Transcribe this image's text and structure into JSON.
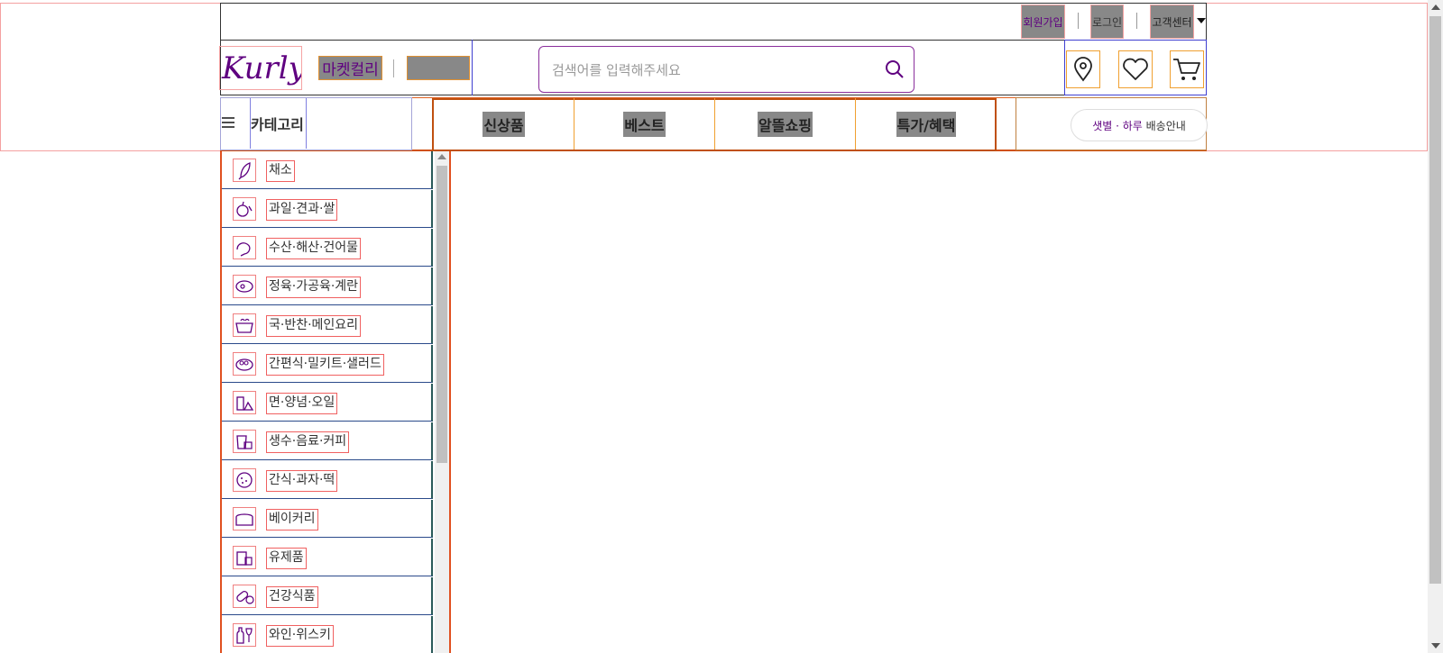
{
  "top_links": {
    "signup": "회원가입",
    "login": "로그인",
    "customer_center": "고객센터"
  },
  "header": {
    "logo_text": "Kurly",
    "market_tab": "마켓컬리",
    "search_placeholder": "검색어를 입력해주세요"
  },
  "nav": {
    "category_label": "카테고리",
    "tabs": [
      "신상품",
      "베스트",
      "알뜰쇼핑",
      "특가/혜택"
    ],
    "delivery_purple": "샛별 · 하루",
    "delivery_rest": " 배송안내"
  },
  "categories": [
    {
      "label": "채소",
      "icon": "vegetable-icon"
    },
    {
      "label": "과일·견과·쌀",
      "icon": "fruit-icon"
    },
    {
      "label": "수산·해산·건어물",
      "icon": "seafood-icon"
    },
    {
      "label": "정육·가공육·계란",
      "icon": "meat-icon"
    },
    {
      "label": "국·반찬·메인요리",
      "icon": "soup-icon"
    },
    {
      "label": "간편식·밀키트·샐러드",
      "icon": "salad-icon"
    },
    {
      "label": "면·양념·오일",
      "icon": "noodle-icon"
    },
    {
      "label": "생수·음료·커피",
      "icon": "drink-icon"
    },
    {
      "label": "간식·과자·떡",
      "icon": "snack-icon"
    },
    {
      "label": "베이커리",
      "icon": "bread-icon"
    },
    {
      "label": "유제품",
      "icon": "dairy-icon"
    },
    {
      "label": "건강식품",
      "icon": "health-icon"
    },
    {
      "label": "와인·위스키",
      "icon": "wine-icon"
    }
  ],
  "colors": {
    "brand": "#5f0080"
  }
}
